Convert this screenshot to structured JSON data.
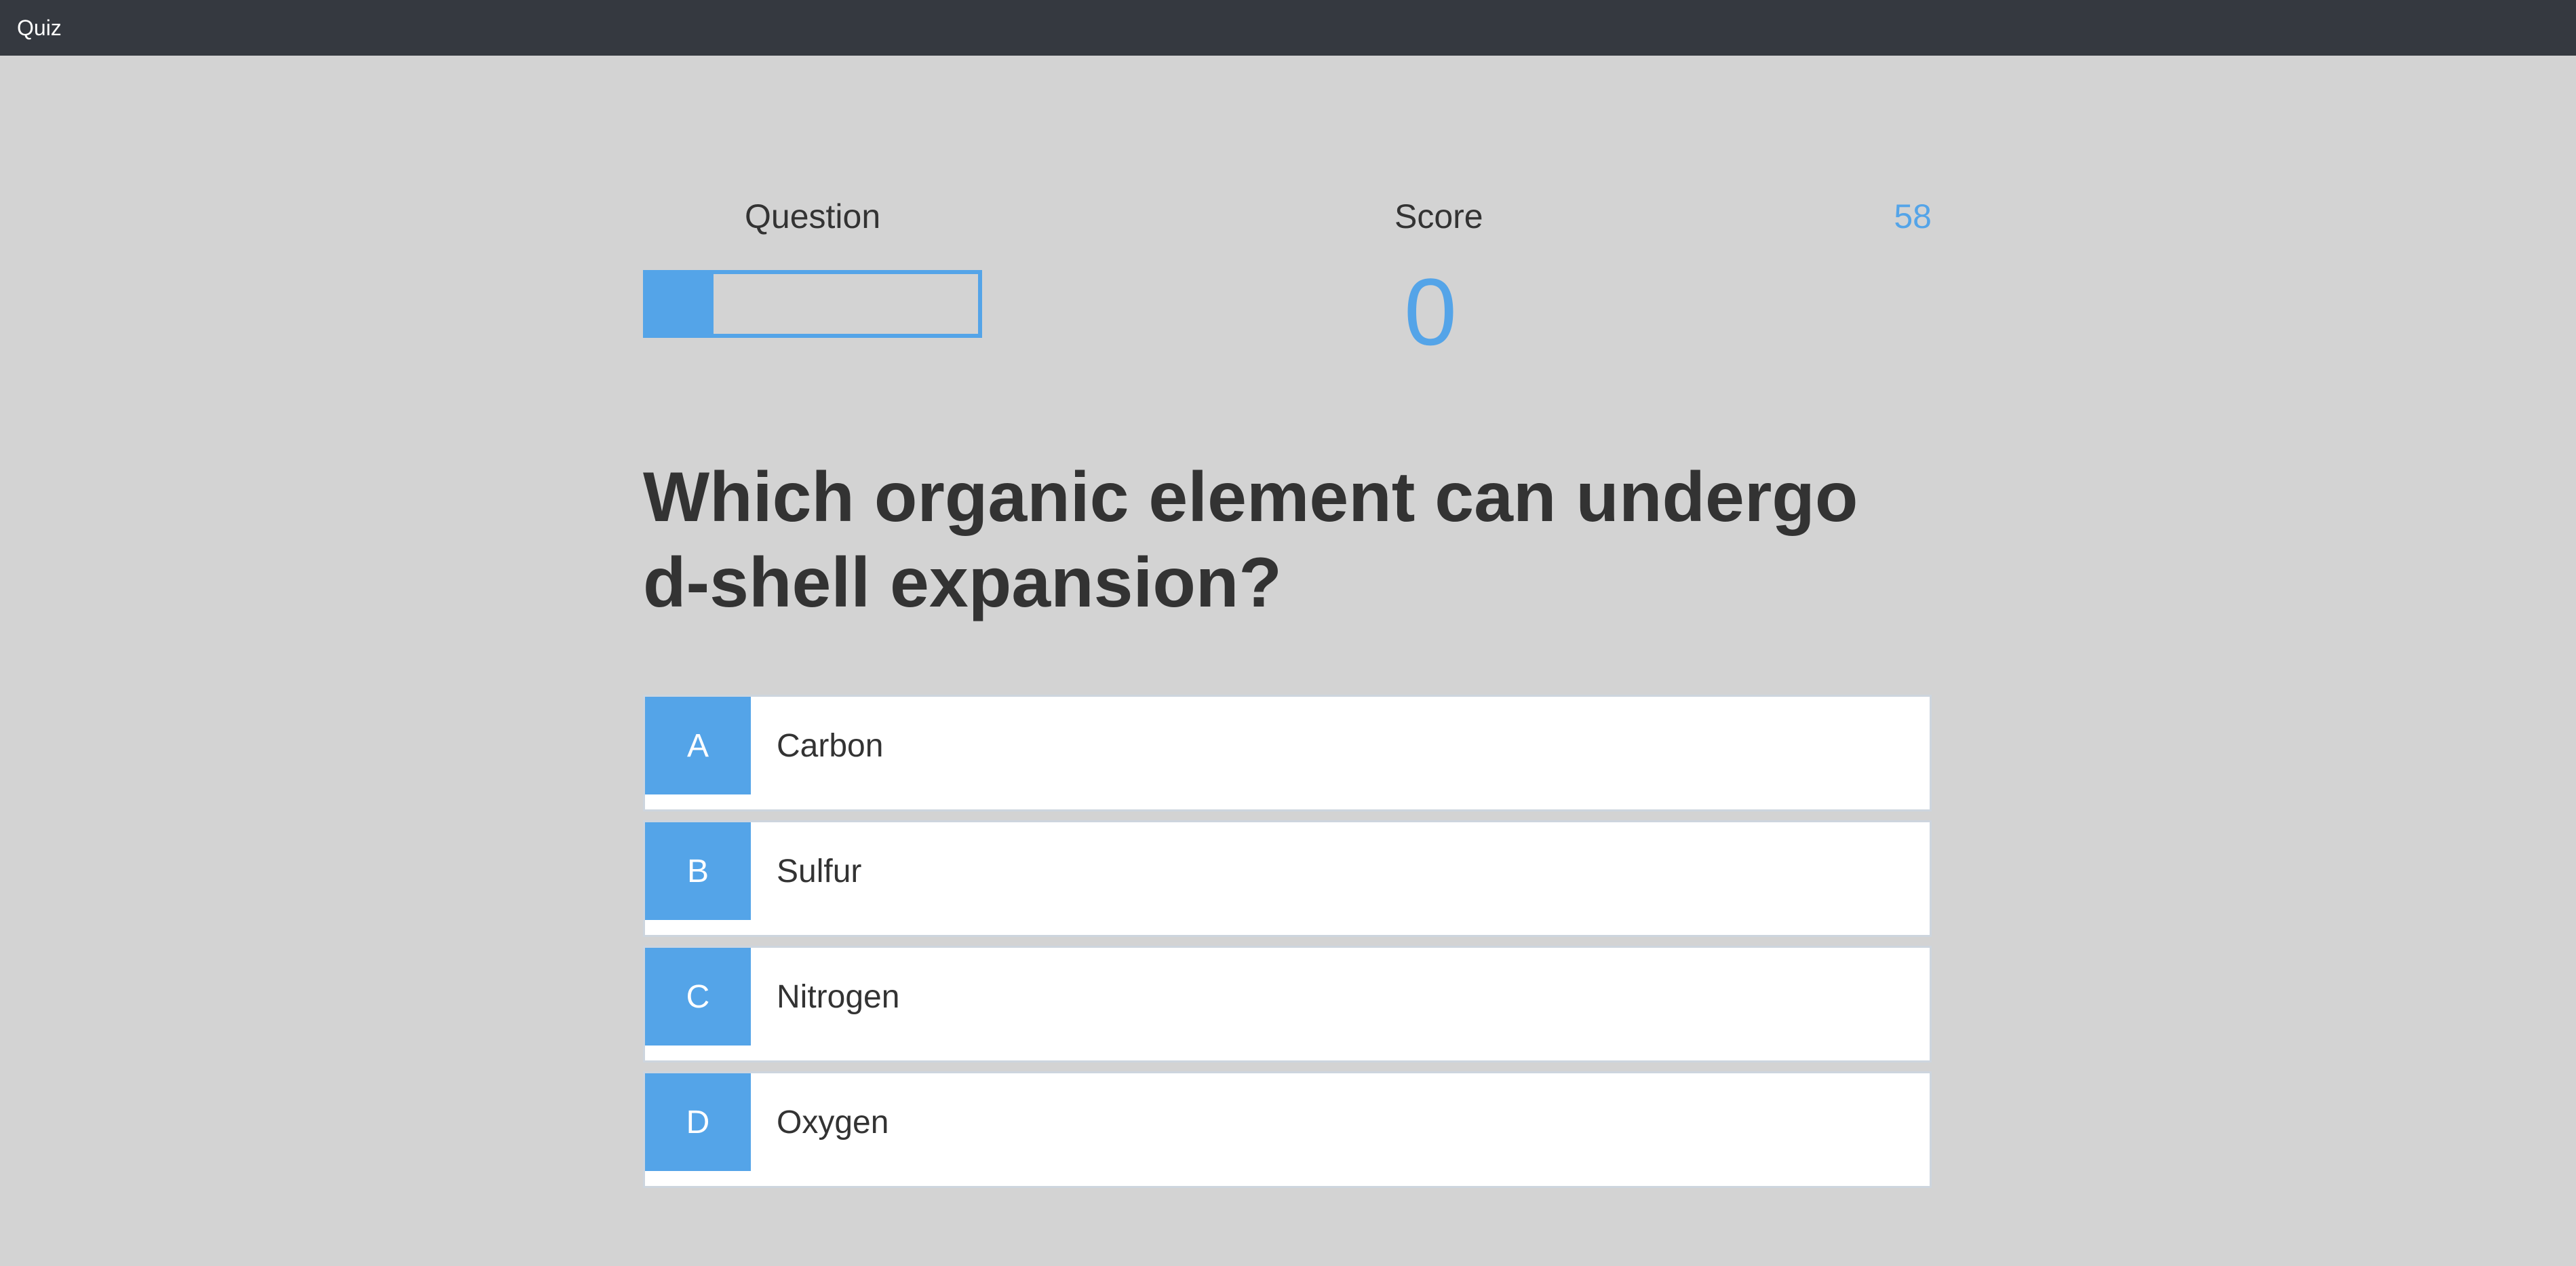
{
  "app": {
    "title": "Quiz"
  },
  "hud": {
    "question_label": "Question",
    "progress_fraction": 0.2,
    "score_label": "Score",
    "score_value": "0",
    "timer_value": "58"
  },
  "question": {
    "text": "Which organic element can undergo d-shell expansion?"
  },
  "choices": [
    {
      "letter": "A",
      "text": "Carbon"
    },
    {
      "letter": "B",
      "text": "Sulfur"
    },
    {
      "letter": "C",
      "text": "Nitrogen"
    },
    {
      "letter": "D",
      "text": "Oxygen"
    }
  ],
  "colors": {
    "accent": "#54a4e8",
    "topbar": "#353940",
    "background": "#d3d3d3",
    "text": "#333333"
  }
}
